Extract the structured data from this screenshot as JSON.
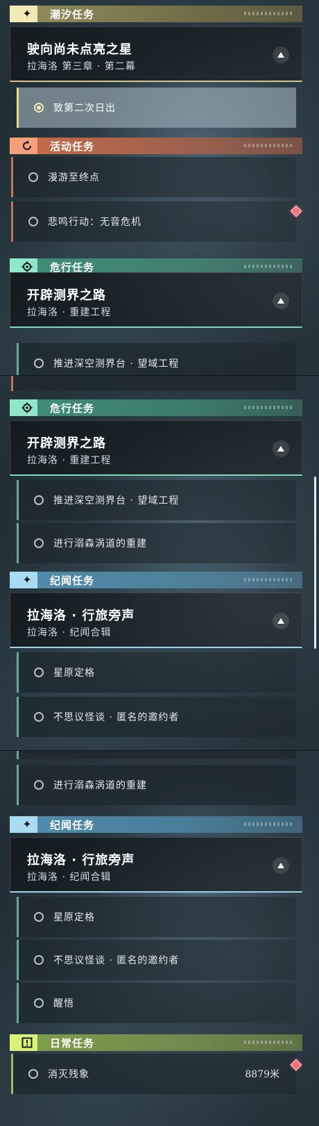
{
  "sections": {
    "tide": "潮汐任务",
    "event": "活动任务",
    "peril": "危行任务",
    "chronicle": "纪闻任务",
    "daily": "日常任务"
  },
  "quests": {
    "tide": {
      "title": "驶向尚未点亮之星",
      "subtitle": "拉海洛 第三章 · 第二幕"
    },
    "peril": {
      "title": "开辟测界之路",
      "subtitle": "拉海洛 · 重建工程"
    },
    "chronicle": {
      "title": "拉海洛 · 行旅旁声",
      "subtitle": "拉海洛 · 纪闻合辑"
    }
  },
  "objectives": {
    "tide_1": "致第二次日出",
    "event_1": "漫游至终点",
    "event_2": "悲鸣行动：无音危机",
    "peril_1": "推进深空测界台 · 望域工程",
    "peril_2": "进行溺森涡道的重建",
    "chron_1": "星原定格",
    "chron_2": "不思议怪谈 · 匿名的邀约者",
    "chron_3": "醒悟",
    "daily_1": "消灭残象",
    "daily_1_distance": "8879米"
  },
  "colors": {
    "tide": "#f1e9b6",
    "event": "#f4a07a",
    "peril": "#8fe6c8",
    "chronicle": "#a9dcf4",
    "daily": "#d9f27a",
    "marker": "#ff6b7a"
  },
  "icons": {
    "tide": "star-icon",
    "event": "refresh-icon",
    "peril": "gear-icon",
    "chronicle": "star-icon",
    "daily": "alert-icon",
    "collapse": "chevron-up-icon",
    "objective": "radio-icon"
  }
}
